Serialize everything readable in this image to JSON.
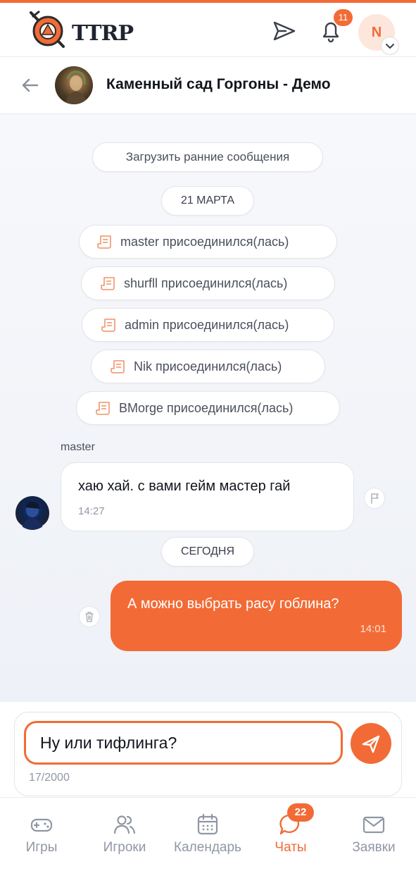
{
  "header": {
    "logo_text": "TTRP",
    "notifications_count": "11",
    "user_initial": "N"
  },
  "chat": {
    "title": "Каменный сад Горгоны - Демо"
  },
  "messages": {
    "load_earlier": "Загрузить ранние сообщения",
    "date_1": "21 МАРТА",
    "system": [
      "master присоединился(лась)",
      "shurfll присоединился(лась)",
      "admin присоединился(лась)",
      "Nik присоединился(лась)",
      "BMorge присоединился(лась)"
    ],
    "incoming": {
      "sender": "master",
      "text": "хаю хай. с вами гейм мастер гай",
      "time": "14:27"
    },
    "date_2": "СЕГОДНЯ",
    "outgoing": {
      "text": "А можно выбрать расу гоблина?",
      "time": "14:01"
    }
  },
  "composer": {
    "value": "Ну или тифлинга?",
    "counter": "17/2000"
  },
  "nav": {
    "items": [
      "Игры",
      "Игроки",
      "Календарь",
      "Чаты",
      "Заявки"
    ],
    "active": "Чаты",
    "chats_badge": "22"
  },
  "colors": {
    "accent": "#f26b36",
    "text": "#12151c",
    "muted": "#9097a4"
  },
  "icons": {
    "header": [
      "logo-compass-icon",
      "send-icon",
      "bell-icon",
      "chevron-down-icon"
    ],
    "chat": [
      "back-arrow-icon",
      "scroll-icon",
      "flag-icon",
      "trash-icon",
      "send-icon"
    ],
    "nav": [
      "gamepad-icon",
      "users-icon",
      "calendar-icon",
      "chat-bubble-icon",
      "mail-icon"
    ]
  }
}
